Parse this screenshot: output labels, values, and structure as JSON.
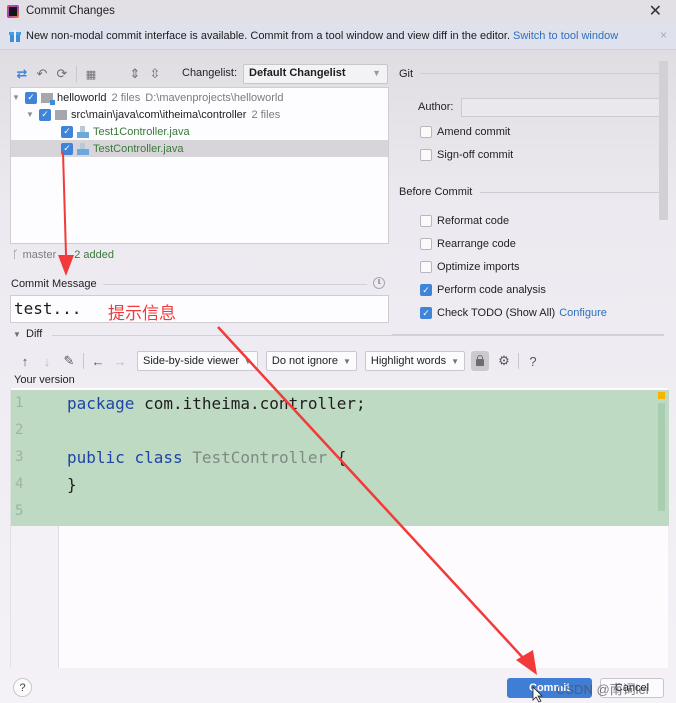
{
  "window": {
    "title": "Commit Changes",
    "close_icon": "close-icon"
  },
  "banner": {
    "icon": "gift-icon",
    "text": "New non-modal commit interface is available. Commit from a tool window and view diff in the editor.",
    "link": "Switch to tool window",
    "close": "×"
  },
  "toolbar": {
    "icons": [
      "show-diff-icon",
      "rollback-icon",
      "refresh-icon",
      "group-by-icon",
      "expand-all-icon",
      "collapse-all-icon"
    ],
    "changelist_label": "Changelist:",
    "changelist_value": "Default Changelist"
  },
  "tree": {
    "root": {
      "name": "helloworld",
      "count": "2 files",
      "path": "D:\\mavenprojects\\helloworld",
      "checked": true
    },
    "folder": {
      "name": "src\\main\\java\\com\\itheima\\controller",
      "count": "2 files",
      "checked": true
    },
    "files": [
      {
        "name": "Test1Controller.java",
        "checked": true,
        "selected": false
      },
      {
        "name": "TestController.java",
        "checked": true,
        "selected": true
      }
    ]
  },
  "status": {
    "branch": "master",
    "added": "2 added"
  },
  "commit_message": {
    "label": "Commit Message",
    "value": "test...",
    "annotation": "提示信息"
  },
  "diff": {
    "label": "Diff",
    "viewer": "Side-by-side viewer",
    "ignore": "Do not ignore",
    "highlight": "Highlight words",
    "help": "?",
    "your_version": "Your version",
    "lines": [
      {
        "n": "1",
        "tokens": [
          {
            "t": "package",
            "c": "kw"
          },
          {
            "t": " com.itheima.controller;",
            "c": ""
          }
        ]
      },
      {
        "n": "2",
        "tokens": []
      },
      {
        "n": "3",
        "tokens": [
          {
            "t": "public",
            "c": "kw"
          },
          {
            "t": " ",
            "c": ""
          },
          {
            "t": "class",
            "c": "kw"
          },
          {
            "t": " ",
            "c": ""
          },
          {
            "t": "TestController",
            "c": "cls"
          },
          {
            "t": " {",
            "c": ""
          }
        ]
      },
      {
        "n": "4",
        "tokens": [
          {
            "t": "}",
            "c": ""
          }
        ]
      },
      {
        "n": "5",
        "tokens": []
      }
    ]
  },
  "git": {
    "label": "Git",
    "author_label": "Author:",
    "author_value": "",
    "amend": {
      "label": "Amend commit",
      "checked": false
    },
    "signoff": {
      "label": "Sign-off commit",
      "checked": false
    }
  },
  "before_commit": {
    "label": "Before Commit",
    "options": [
      {
        "label": "Reformat code",
        "checked": false
      },
      {
        "label": "Rearrange code",
        "checked": false
      },
      {
        "label": "Optimize imports",
        "checked": false
      },
      {
        "label": "Perform code analysis",
        "checked": true
      },
      {
        "label": "Check TODO (Show All)",
        "checked": true,
        "link": "Configure"
      }
    ]
  },
  "buttons": {
    "help": "?",
    "commit": "Commit",
    "cancel": "Cancel"
  },
  "watermark": "CSDN @南词lei",
  "annotation_color": "#f23a3a",
  "accent": "#3f7ed4"
}
